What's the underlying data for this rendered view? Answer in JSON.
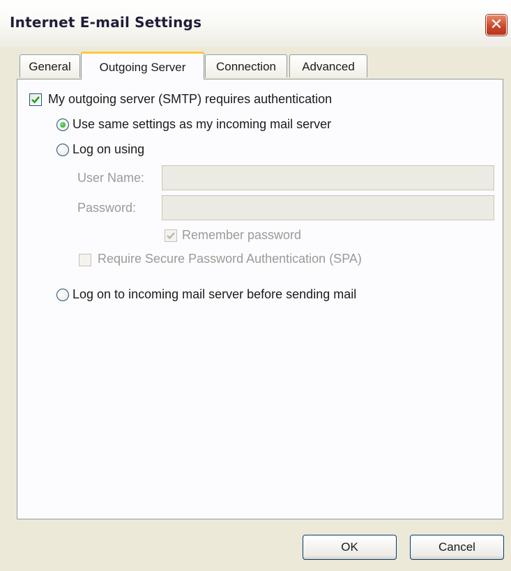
{
  "window": {
    "title": "Internet E-mail Settings",
    "close_icon": "close-icon",
    "close_glyph": "✕"
  },
  "tabs": [
    {
      "label": "General",
      "active": false
    },
    {
      "label": "Outgoing Server",
      "active": true
    },
    {
      "label": "Connection",
      "active": false
    },
    {
      "label": "Advanced",
      "active": false
    }
  ],
  "outgoing": {
    "smtp_auth": {
      "label": "My outgoing server (SMTP) requires authentication",
      "checked": true
    },
    "same_settings": {
      "label": "Use same settings as my incoming mail server",
      "selected": true
    },
    "log_on_using": {
      "label": "Log on using",
      "selected": false
    },
    "user_name": {
      "label": "User Name:",
      "value": "",
      "enabled": false
    },
    "password": {
      "label": "Password:",
      "value": "",
      "enabled": false
    },
    "remember_password": {
      "label": "Remember password",
      "checked": true,
      "enabled": false
    },
    "spa": {
      "label": "Require Secure Password Authentication (SPA)",
      "checked": false,
      "enabled": false
    },
    "log_on_incoming": {
      "label": "Log on to incoming mail server before sending mail",
      "selected": false
    }
  },
  "buttons": {
    "ok": "OK",
    "cancel": "Cancel"
  },
  "colors": {
    "accent_tab": "#ffc83c",
    "close_red": "#c9452a",
    "check_green": "#21a121"
  }
}
